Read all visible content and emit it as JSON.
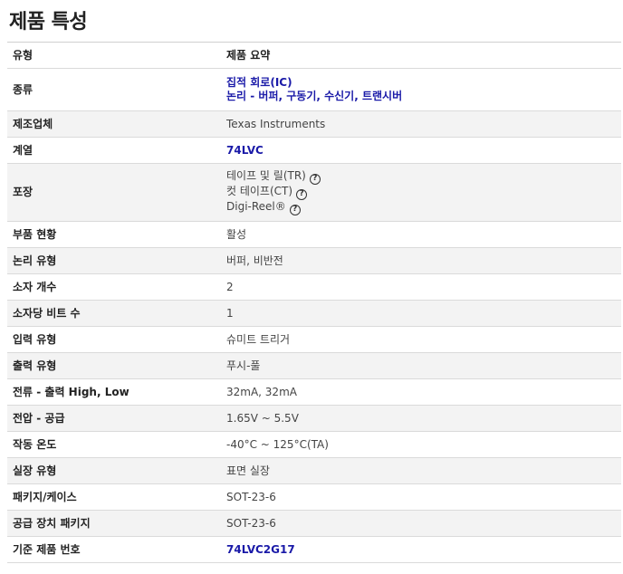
{
  "title": "제품 특성",
  "header": {
    "type_label": "유형",
    "summary_label": "제품 요약"
  },
  "rows": {
    "category": {
      "label": "종류",
      "values": [
        "집적 회로(IC)",
        "논리 - 버퍼, 구동기, 수신기, 트랜시버"
      ]
    },
    "manufacturer": {
      "label": "제조업체",
      "value": "Texas Instruments"
    },
    "series": {
      "label": "계열",
      "value": "74LVC"
    },
    "packaging": {
      "label": "포장",
      "values": [
        "테이프 및 릴(TR)",
        "컷 테이프(CT)",
        "Digi-Reel®"
      ],
      "help_icon": "question-circle-icon",
      "help_glyph": "?"
    },
    "part_status": {
      "label": "부품 현황",
      "value": "활성"
    },
    "logic_type": {
      "label": "논리 유형",
      "value": "버퍼, 비반전"
    },
    "num_elements": {
      "label": "소자 개수",
      "value": "2"
    },
    "bits_per_element": {
      "label": "소자당 비트 수",
      "value": "1"
    },
    "input_type": {
      "label": "입력 유형",
      "value": "슈미트 트리거"
    },
    "output_type": {
      "label": "출력 유형",
      "value": "푸시-풀"
    },
    "current_output": {
      "label": "전류 - 출력 High, Low",
      "value": "32mA, 32mA"
    },
    "voltage_supply": {
      "label": "전압 - 공급",
      "value": "1.65V ~ 5.5V"
    },
    "operating_temp": {
      "label": "작동 온도",
      "value": "-40°C ~ 125°C(TA)"
    },
    "mounting_type": {
      "label": "실장 유형",
      "value": "표면 실장"
    },
    "package_case": {
      "label": "패키지/케이스",
      "value": "SOT-23-6"
    },
    "supplier_package": {
      "label": "공급 장치 패키지",
      "value": "SOT-23-6"
    },
    "base_part_number": {
      "label": "기준 제품 번호",
      "value": "74LVC2G17"
    }
  },
  "colors": {
    "link": "#1a1aa8",
    "alt_row": "#f3f3f3",
    "border": "#dadada"
  }
}
